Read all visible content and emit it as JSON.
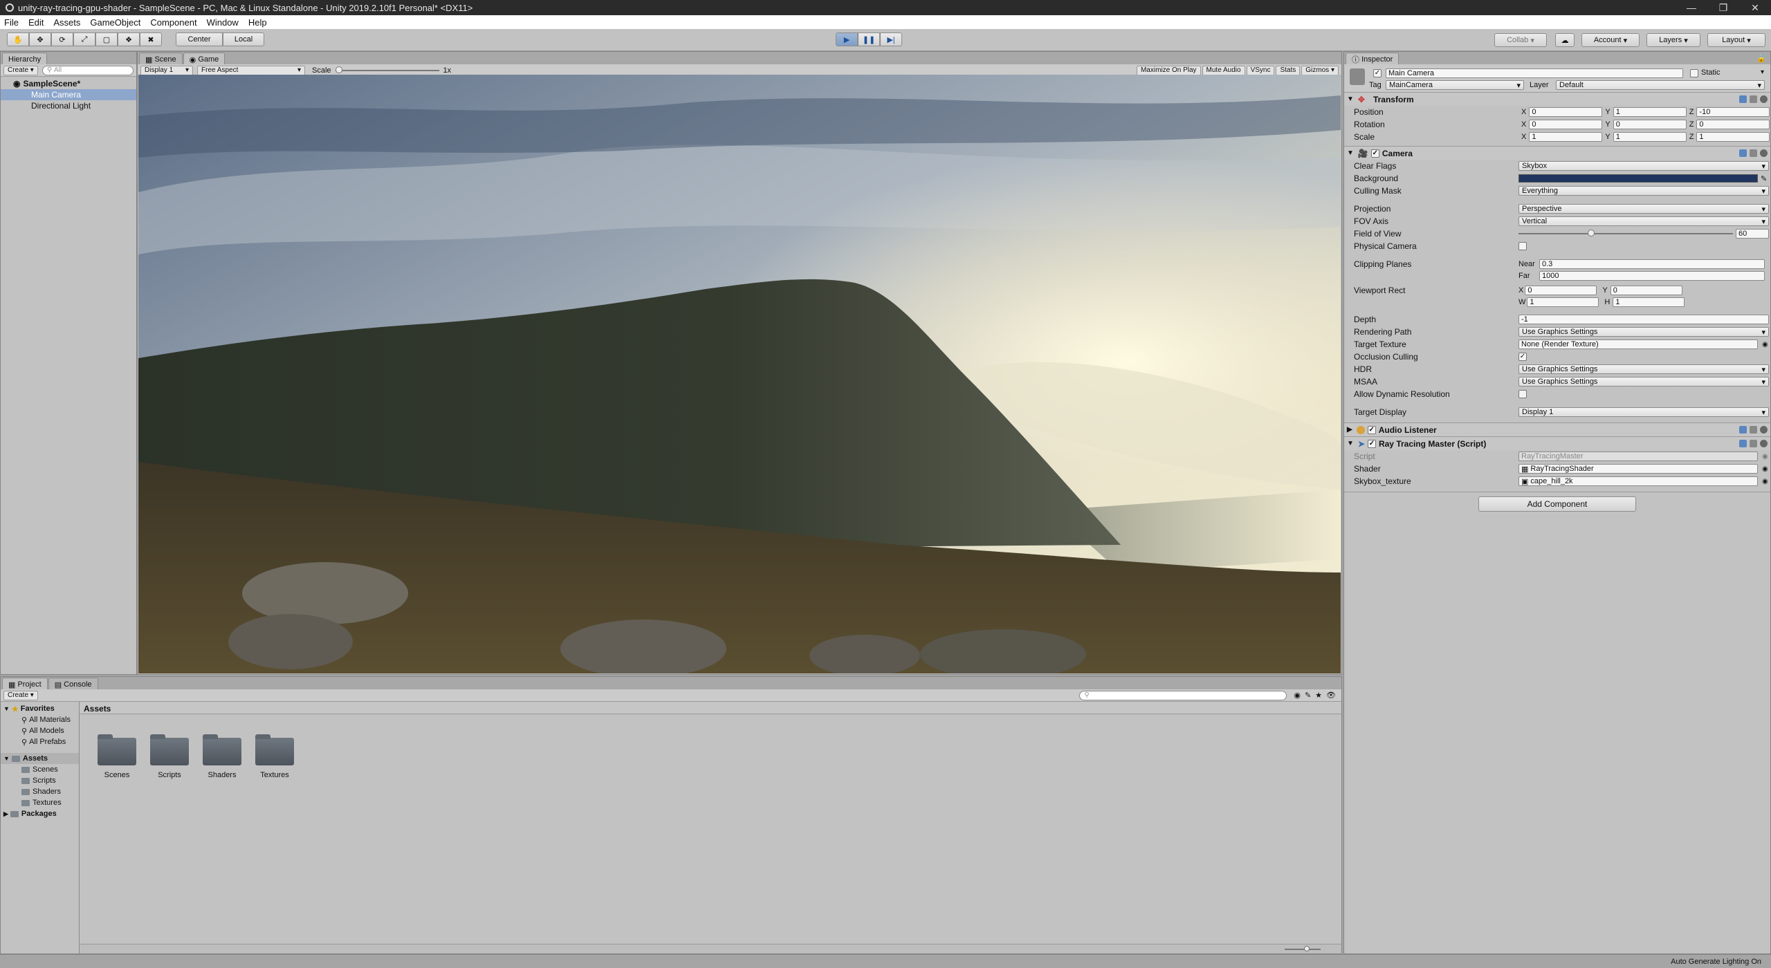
{
  "window": {
    "title": "unity-ray-tracing-gpu-shader - SampleScene - PC, Mac & Linux Standalone - Unity 2019.2.10f1 Personal* <DX11>"
  },
  "menu": [
    "File",
    "Edit",
    "Assets",
    "GameObject",
    "Component",
    "Window",
    "Help"
  ],
  "toolbar": {
    "center_label": "Center",
    "local_label": "Local",
    "collab_label": "Collab",
    "account_label": "Account",
    "layers_label": "Layers",
    "layout_label": "Layout"
  },
  "hierarchy": {
    "tab": "Hierarchy",
    "create_label": "Create",
    "search_placeholder": "All",
    "scene_name": "SampleScene*",
    "items": [
      "Main Camera",
      "Directional Light"
    ]
  },
  "scene_tabs": {
    "scene": "Scene",
    "game": "Game"
  },
  "game_bar": {
    "display": "Display 1",
    "aspect": "Free Aspect",
    "scale_label": "Scale",
    "scale_value": "1x",
    "maximize": "Maximize On Play",
    "mute": "Mute Audio",
    "vsync": "VSync",
    "stats": "Stats",
    "gizmos": "Gizmos"
  },
  "inspector": {
    "tab": "Inspector",
    "object_name": "Main Camera",
    "static_label": "Static",
    "tag_label": "Tag",
    "tag_value": "MainCamera",
    "layer_label": "Layer",
    "layer_value": "Default",
    "transform": {
      "title": "Transform",
      "position_label": "Position",
      "position": [
        "0",
        "1",
        "-10"
      ],
      "rotation_label": "Rotation",
      "rotation": [
        "0",
        "0",
        "0"
      ],
      "scale_label": "Scale",
      "scale": [
        "1",
        "1",
        "1"
      ]
    },
    "camera": {
      "title": "Camera",
      "clear_flags_label": "Clear Flags",
      "clear_flags": "Skybox",
      "background_label": "Background",
      "background_color": "#1f3560",
      "culling_mask_label": "Culling Mask",
      "culling_mask": "Everything",
      "projection_label": "Projection",
      "projection": "Perspective",
      "fov_axis_label": "FOV Axis",
      "fov_axis": "Vertical",
      "fov_label": "Field of View",
      "fov": "60",
      "physical_label": "Physical Camera",
      "clipping_label": "Clipping Planes",
      "near_label": "Near",
      "near": "0.3",
      "far_label": "Far",
      "far": "1000",
      "viewport_label": "Viewport Rect",
      "vp_x": "0",
      "vp_y": "0",
      "vp_w": "1",
      "vp_h": "1",
      "depth_label": "Depth",
      "depth": "-1",
      "rendering_path_label": "Rendering Path",
      "rendering_path": "Use Graphics Settings",
      "target_texture_label": "Target Texture",
      "target_texture": "None (Render Texture)",
      "occlusion_label": "Occlusion Culling",
      "hdr_label": "HDR",
      "hdr": "Use Graphics Settings",
      "msaa_label": "MSAA",
      "msaa": "Use Graphics Settings",
      "dynres_label": "Allow Dynamic Resolution",
      "target_display_label": "Target Display",
      "target_display": "Display 1"
    },
    "audio_listener": {
      "title": "Audio Listener"
    },
    "ray_tracing": {
      "title": "Ray Tracing Master (Script)",
      "script_label": "Script",
      "script": "RayTracingMaster",
      "shader_label": "Shader",
      "shader": "RayTracingShader",
      "skybox_label": "Skybox_texture",
      "skybox": "cape_hill_2k"
    },
    "add_component": "Add Component"
  },
  "project": {
    "tabs": [
      "Project",
      "Console"
    ],
    "create_label": "Create",
    "favorites_label": "Favorites",
    "favorites": [
      "All Materials",
      "All Models",
      "All Prefabs"
    ],
    "assets_label": "Assets",
    "asset_folders": [
      "Scenes",
      "Scripts",
      "Shaders",
      "Textures"
    ],
    "packages_label": "Packages",
    "breadcrumb": "Assets",
    "folders": [
      "Scenes",
      "Scripts",
      "Shaders",
      "Textures"
    ]
  },
  "status": {
    "text": "Auto Generate Lighting On"
  }
}
